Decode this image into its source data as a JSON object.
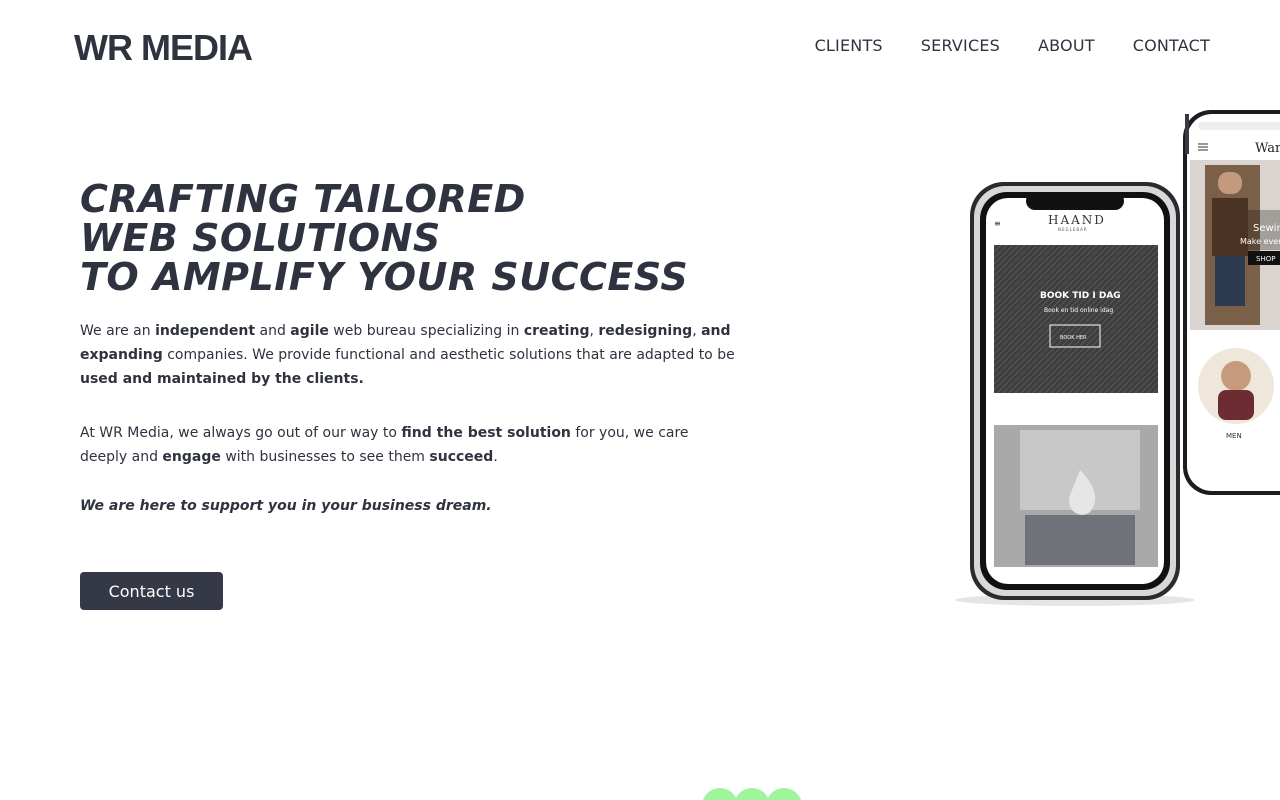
{
  "header": {
    "logo_text": "WR MEDIA",
    "nav": [
      {
        "label": "CLIENTS"
      },
      {
        "label": "SERVICES"
      },
      {
        "label": "ABOUT"
      },
      {
        "label": "CONTACT"
      }
    ]
  },
  "hero": {
    "headline": [
      "CRAFTING TAILORED",
      "WEB SOLUTIONS",
      "TO AMPLIFY YOUR SUCCESS"
    ],
    "para1": {
      "t1": "We are an ",
      "b1": "independent",
      "t2": " and ",
      "b2": "agile",
      "t3": " web bureau specializing in ",
      "b3": "creating",
      "t4": ", ",
      "b4": "redesigning",
      "t5": ", ",
      "b5": "and expanding",
      "t6": " companies. We provide functional and aesthetic solutions that are adapted to be ",
      "b6": "used and maintained by the clients."
    },
    "para2": {
      "t1": "At WR Media, we always go out of our way to ",
      "b1": "find the best solution",
      "t2": " for you, we care deeply and ",
      "b2": "engage",
      "t3": " with businesses to see them ",
      "b3": "succeed",
      "t4": "."
    },
    "tagline": "We are here to support you in your business dream.",
    "cta_label": "Contact us"
  },
  "mockups": {
    "front_phone": {
      "brand": "HAAND",
      "brand_sub": "NEGLEBAR",
      "card_title": "BOOK TID I DAG",
      "card_sub": "Book en tid online idag",
      "card_button": "BOOK HER"
    },
    "back_phone": {
      "brand": "Ward",
      "banner_title": "Sewing is",
      "banner_sub": "Make every",
      "banner_button": "SHOP",
      "category": "MEN"
    }
  },
  "colors": {
    "text": "#2f3340",
    "button_bg": "#353845",
    "blob": "#9ff59a"
  }
}
